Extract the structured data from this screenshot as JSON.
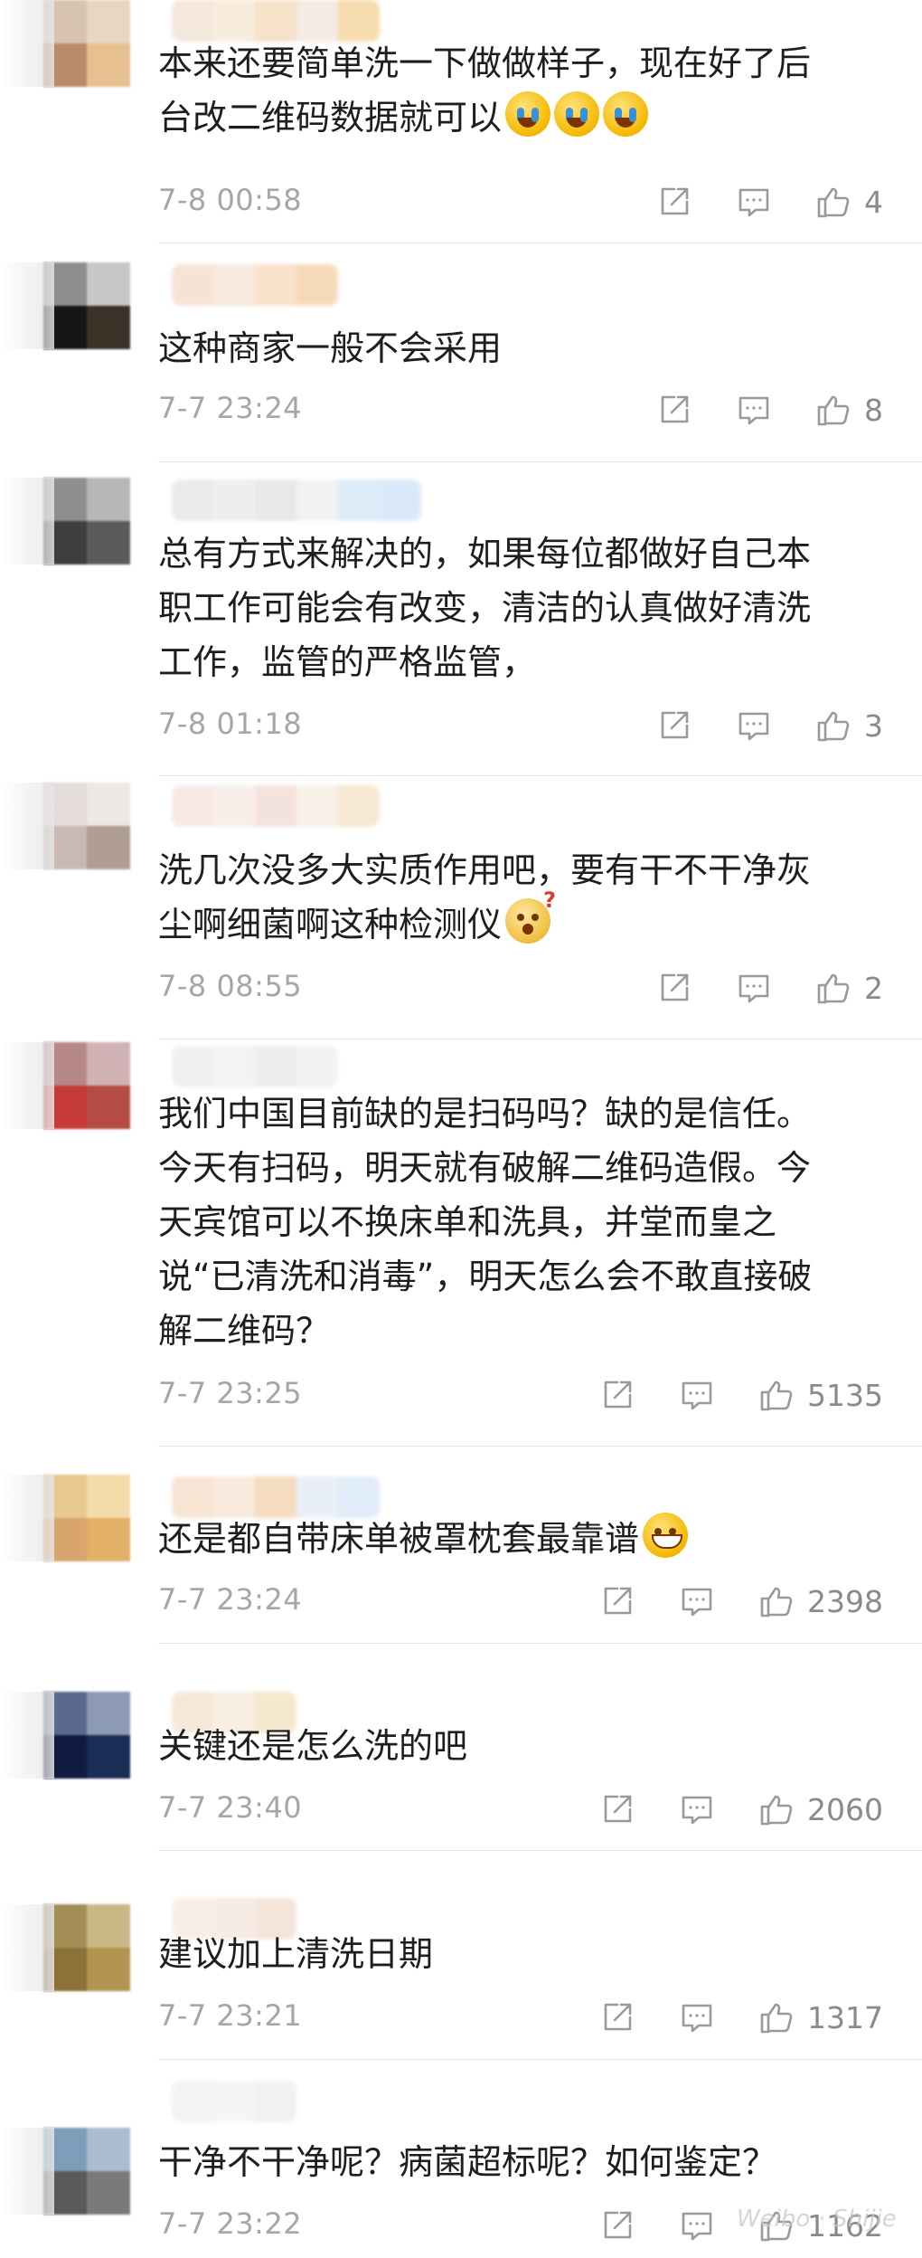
{
  "comments": [
    {
      "text_lines": [
        "本来还要简单洗一下做做样子，现在好了后",
        "台改二维码数据就可以"
      ],
      "emojis": [
        "cry",
        "cry",
        "cry"
      ],
      "time": "7-8 00:58",
      "likes": "4",
      "avatar_colors": [
        "#d7c3b0",
        "#e9d6c2",
        "#b98a6b",
        "#e7c08f"
      ],
      "name_colors": [
        "#f3e3d6",
        "#f7ead8",
        "#f5dcc0",
        "#f2e8e0",
        "#f5d6a0"
      ]
    },
    {
      "text_lines": [
        "这种商家一般不会采用"
      ],
      "emojis": [],
      "time": "7-7 23:24",
      "likes": "8",
      "avatar_colors": [
        "#8e8e8e",
        "#c7c7c7",
        "#151515",
        "#3b3228"
      ],
      "name_colors": [
        "#f4dfcf",
        "#f5e7d8",
        "#f7ddc2",
        "#f5d3b0"
      ]
    },
    {
      "text_lines": [
        "总有方式来解决的，如果每位都做好自己本",
        "职工作可能会有改变，清洁的认真做好清洗",
        "工作，监管的严格监管，"
      ],
      "emojis": [],
      "time": "7-8 01:18",
      "likes": "3",
      "avatar_colors": [
        "#8f8f8f",
        "#b7b7b7",
        "#3e3e3e",
        "#5b5b5b"
      ],
      "name_colors": [
        "#e8e8e8",
        "#ececec",
        "#e4e4e4",
        "#f0f0f0",
        "#d8e8f7",
        "#d4e6f8"
      ]
    },
    {
      "text_lines": [
        "洗几次没多大实质作用吧，要有干不干净灰",
        "尘啊细菌啊这种检测仪"
      ],
      "emojis": [
        "ques"
      ],
      "time": "7-8 08:55",
      "likes": "2",
      "avatar_colors": [
        "#e3dcd9",
        "#ece8e6",
        "#c9b9b2",
        "#b09d94"
      ],
      "name_colors": [
        "#f6e6e0",
        "#f7ece6",
        "#f3dfd6",
        "#f7efe4",
        "#f6e4cc"
      ]
    },
    {
      "text_lines": [
        "我们中国目前缺的是扫码吗？缺的是信任。",
        "今天有扫码，明天就有破解二维码造假。今",
        "天宾馆可以不换床单和洗具，并堂而皇之",
        "说“已清洗和消毒”，明天怎么会不敢直接破",
        "解二维码？"
      ],
      "emojis": [],
      "time": "7-7 23:25",
      "likes": "5135",
      "avatar_colors": [
        "#b7888a",
        "#d1b3b5",
        "#c63a3a",
        "#b44c44"
      ],
      "name_colors": [
        "#eeeeee",
        "#f1f1f1",
        "#ebebeb",
        "#f0f0f0"
      ]
    },
    {
      "text_lines": [
        "还是都自带床单被罩枕套最靠谱"
      ],
      "emojis": [
        "grin"
      ],
      "time": "7-7 23:24",
      "likes": "2398",
      "avatar_colors": [
        "#e8c98f",
        "#f3dcaa",
        "#d8a66d",
        "#e3b067"
      ],
      "name_colors": [
        "#f6e0cc",
        "#f7e8d8",
        "#f4d6b4",
        "#e6edf5",
        "#dbe9f7"
      ]
    },
    {
      "text_lines": [
        "关键还是怎么洗的吧"
      ],
      "emojis": [],
      "time": "7-7 23:40",
      "likes": "2060",
      "avatar_colors": [
        "#5a6a8c",
        "#8d9ab3",
        "#0f1b3f",
        "#1a2d55"
      ],
      "name_colors": [
        "#f6e6d4",
        "#f7ecde",
        "#f5e4c6"
      ]
    },
    {
      "text_lines": [
        "建议加上清洗日期"
      ],
      "emojis": [],
      "time": "7-7 23:21",
      "likes": "1317",
      "avatar_colors": [
        "#a38f56",
        "#c9b885",
        "#8c7236",
        "#b39450"
      ],
      "name_colors": [
        "#f7ece4",
        "#f6e9df",
        "#f4e0d4"
      ]
    },
    {
      "text_lines": [
        "干净不干净呢？病菌超标呢？如何鉴定？"
      ],
      "emojis": [],
      "time": "7-7 23:22",
      "likes": "1162",
      "avatar_colors": [
        "#7d9dbb",
        "#a9bcd0",
        "#5a5a5a",
        "#7a7a7a"
      ],
      "name_colors": [
        "#f1f1f1",
        "#f4f4f4",
        "#efefef"
      ]
    }
  ],
  "watermark": "Weibo · Shijie"
}
